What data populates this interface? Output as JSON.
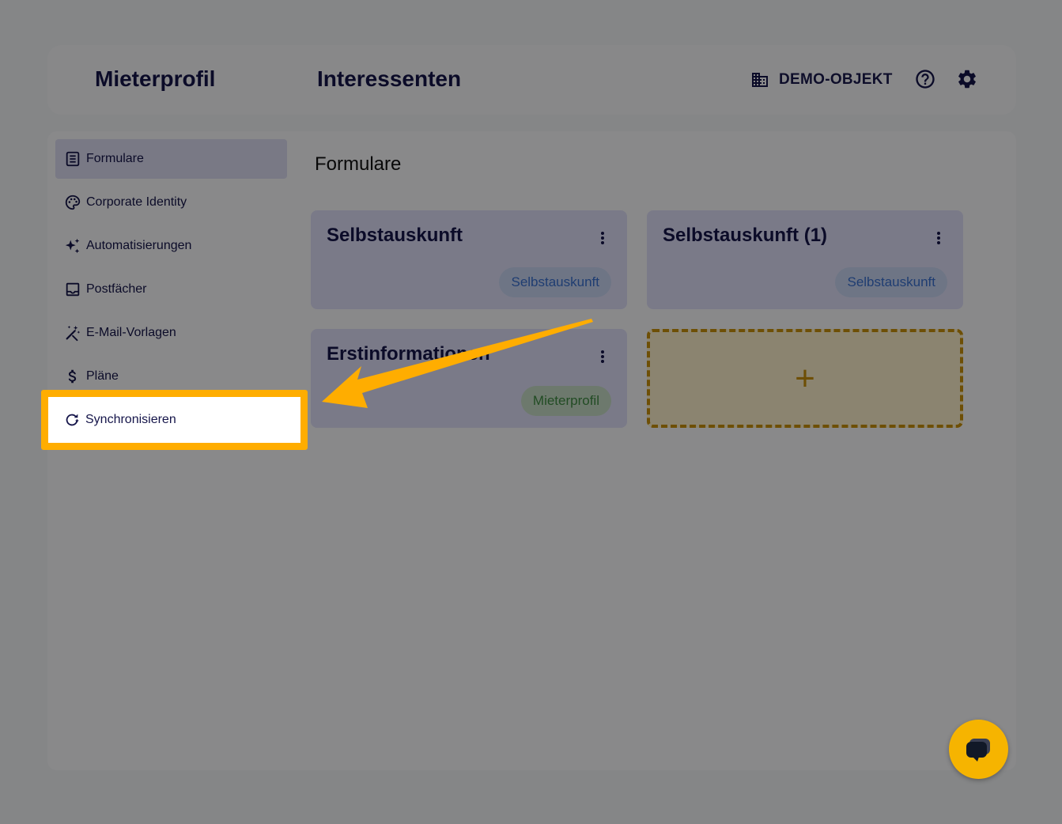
{
  "header": {
    "nav": [
      "Mieterprofil",
      "Interessenten"
    ],
    "object_label": "DEMO-OBJEKT"
  },
  "sidebar": {
    "items": [
      {
        "label": "Formulare",
        "icon": "form-icon",
        "active": true
      },
      {
        "label": "Corporate Identity",
        "icon": "palette-icon"
      },
      {
        "label": "Automatisierungen",
        "icon": "sparkles-icon"
      },
      {
        "label": "Postfächer",
        "icon": "inbox-icon"
      },
      {
        "label": "E-Mail-Vorlagen",
        "icon": "magic-wand-icon"
      },
      {
        "label": "Pläne",
        "icon": "dollar-icon"
      },
      {
        "label": "Synchronisieren",
        "icon": "sync-icon",
        "highlighted": true
      }
    ]
  },
  "main": {
    "title": "Formulare",
    "cards": [
      {
        "title": "Selbstauskunft",
        "tag": "Selbstauskunft",
        "tag_color": "blue"
      },
      {
        "title": "Selbstauskunft (1)",
        "tag": "Selbstauskunft",
        "tag_color": "blue"
      },
      {
        "title": "Erstinformationen",
        "tag": "Mieterprofil",
        "tag_color": "green"
      }
    ],
    "add_label": "+"
  },
  "colors": {
    "accent": "#ffad00",
    "primary_text": "#15154a",
    "card_bg": "#dfdff7"
  }
}
